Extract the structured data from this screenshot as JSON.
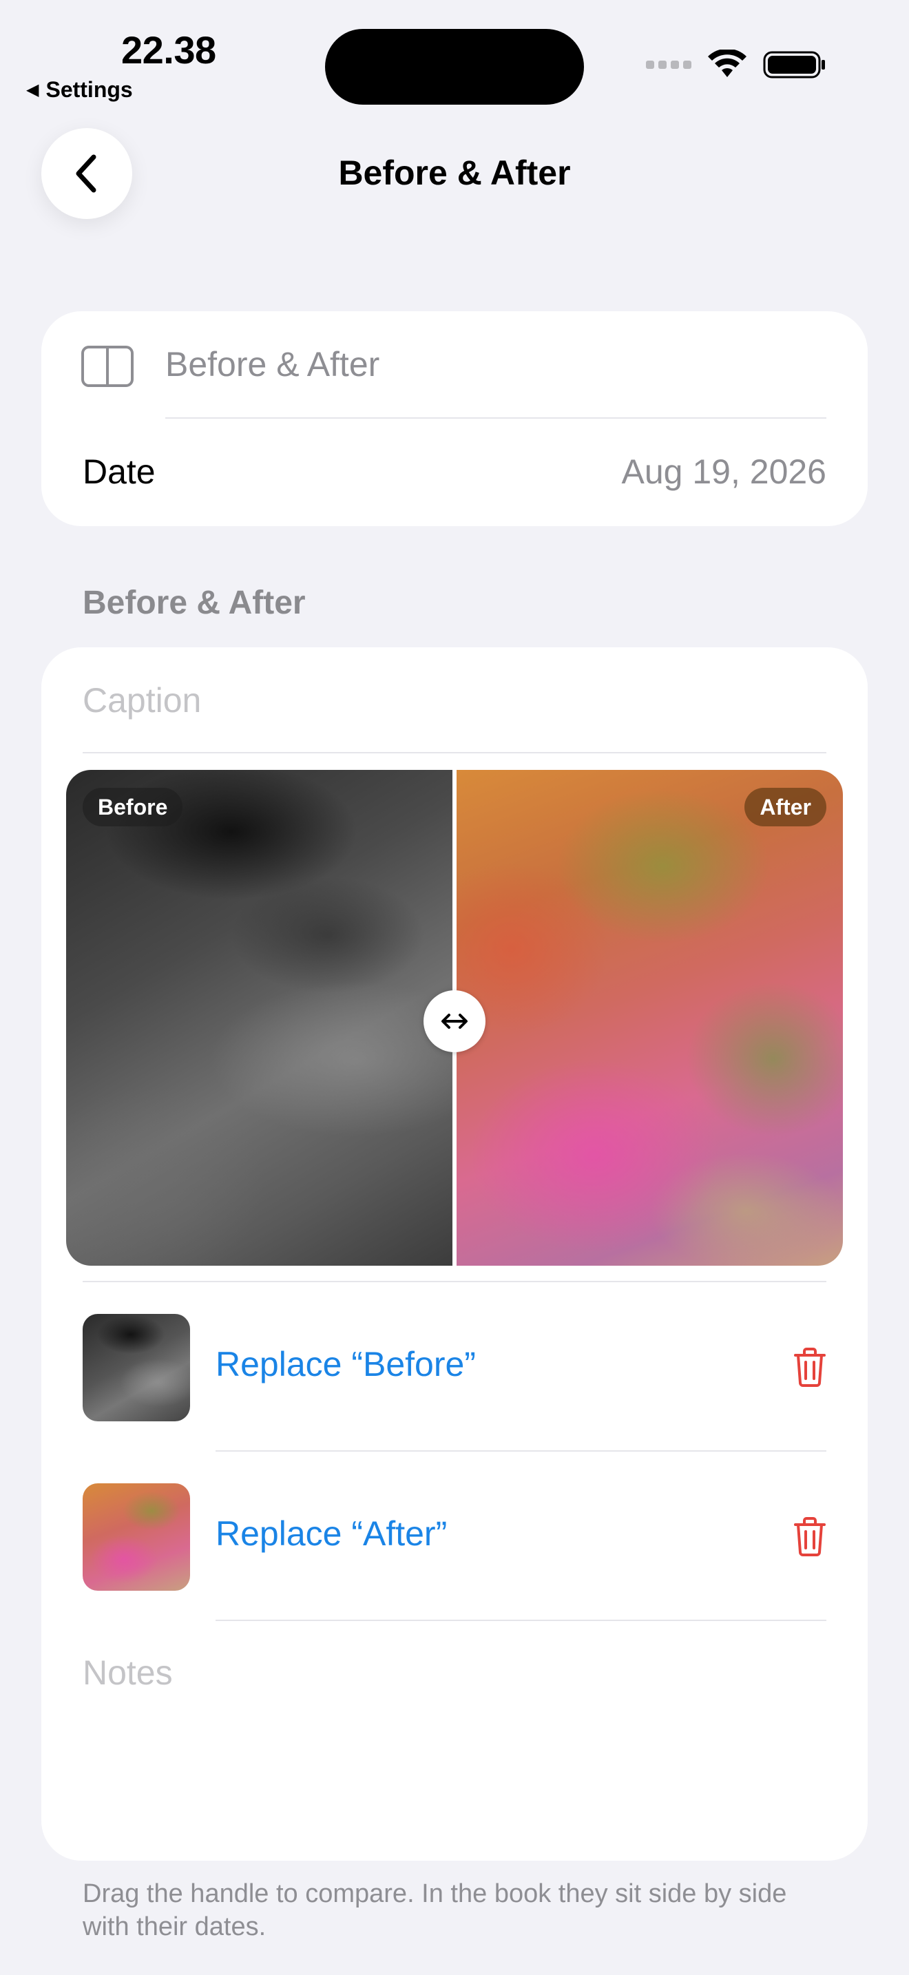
{
  "status_bar": {
    "time": "22.38",
    "back_app": "Settings",
    "back_arrow": "◀"
  },
  "nav": {
    "title": "Before & After",
    "back_icon": "chevron-left-icon"
  },
  "details": {
    "title_placeholder": "Before & After",
    "layout_icon": "split-layout-icon",
    "date_label": "Date",
    "date_value": "Aug 19, 2026"
  },
  "section": {
    "header": "Before & After",
    "caption_placeholder": "Caption",
    "compare": {
      "before_badge": "Before",
      "after_badge": "After",
      "handle_glyph": "↔"
    },
    "media": [
      {
        "label": "Replace “Before”",
        "thumb": "before",
        "delete_icon": "trash-icon"
      },
      {
        "label": "Replace “After”",
        "thumb": "after",
        "delete_icon": "trash-icon"
      }
    ],
    "notes_placeholder": "Notes"
  },
  "footer": "Drag the handle to compare. In the book they sit side by side with their dates.",
  "colors": {
    "accent": "#1a84e6",
    "destructive": "#e5423b",
    "background": "#f2f2f7",
    "secondary_text": "#8e8e93"
  }
}
